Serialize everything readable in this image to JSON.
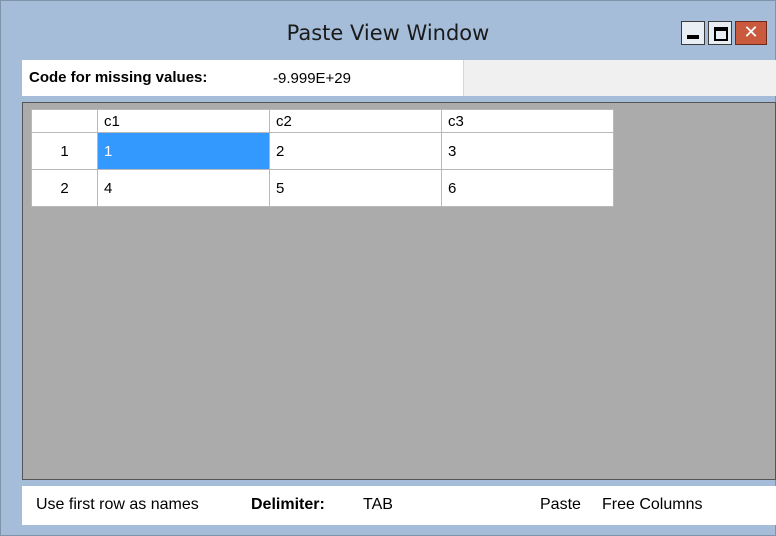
{
  "window": {
    "title": "Paste View Window",
    "close_glyph": "✕"
  },
  "missing": {
    "label": "Code for missing values:",
    "value": "-9.999E+29"
  },
  "grid": {
    "columns": [
      "c1",
      "c2",
      "c3"
    ],
    "rows": [
      {
        "index": "1",
        "cells": [
          "1",
          "2",
          "3"
        ]
      },
      {
        "index": "2",
        "cells": [
          "4",
          "5",
          "6"
        ]
      }
    ],
    "selected_cell": "row1-c1"
  },
  "status": {
    "use_first_row": "Use first row as names",
    "delimiter_label": "Delimiter:",
    "delimiter_value": "TAB",
    "paste": "Paste",
    "free_columns": "Free Columns"
  },
  "colors": {
    "window_frame": "#a5bdd8",
    "grid_background": "#ababab",
    "selection": "#3399ff",
    "close_button": "#c95a3e"
  },
  "icons": [
    "minimize-icon",
    "maximize-icon",
    "close-icon"
  ]
}
